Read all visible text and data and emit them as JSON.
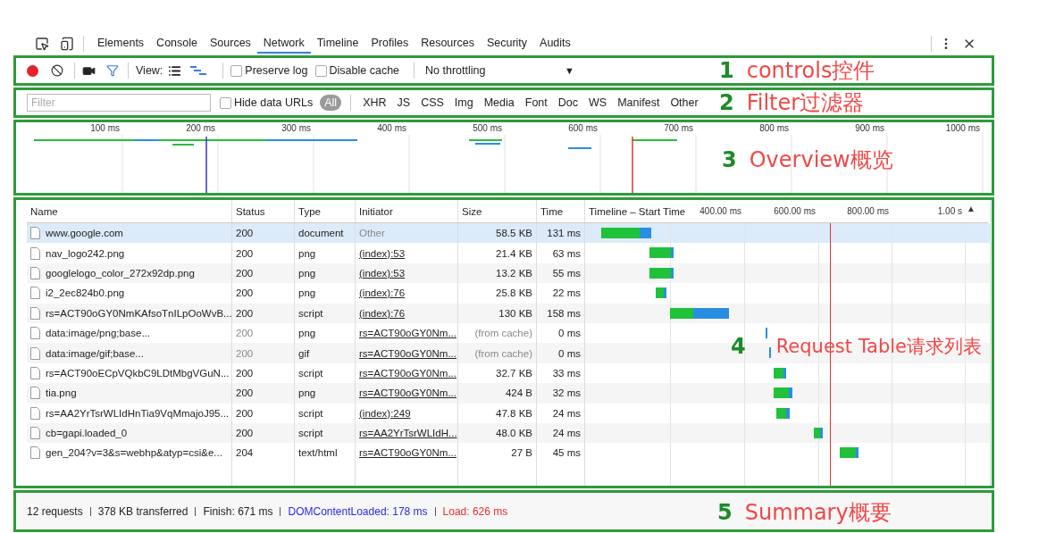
{
  "devtools_tabs": [
    {
      "label": "Elements",
      "selected": false
    },
    {
      "label": "Console",
      "selected": false
    },
    {
      "label": "Sources",
      "selected": false
    },
    {
      "label": "Network",
      "selected": true
    },
    {
      "label": "Timeline",
      "selected": false
    },
    {
      "label": "Profiles",
      "selected": false
    },
    {
      "label": "Resources",
      "selected": false
    },
    {
      "label": "Security",
      "selected": false
    },
    {
      "label": "Audits",
      "selected": false
    }
  ],
  "controls": {
    "record_on": true,
    "filter_on": true,
    "view_label": "View:",
    "view_modes": [
      {
        "kind": "list",
        "selected": false
      },
      {
        "kind": "waterfall",
        "selected": true
      }
    ],
    "preserve_log": {
      "label": "Preserve log",
      "checked": false
    },
    "disable_cache": {
      "label": "Disable cache",
      "checked": false
    },
    "throttling": "No throttling",
    "dropdown_arrow": "▼",
    "annotation": {
      "number": "1",
      "label": "controls控件"
    }
  },
  "filter": {
    "placeholder": "Filter",
    "hide_data_urls": {
      "label": "Hide data URLs",
      "checked": false
    },
    "types": [
      {
        "label": "All",
        "selected": true
      },
      {
        "label": "XHR",
        "selected": false
      },
      {
        "label": "JS",
        "selected": false
      },
      {
        "label": "CSS",
        "selected": false
      },
      {
        "label": "Img",
        "selected": false
      },
      {
        "label": "Media",
        "selected": false
      },
      {
        "label": "Font",
        "selected": false
      },
      {
        "label": "Doc",
        "selected": false
      },
      {
        "label": "WS",
        "selected": false
      },
      {
        "label": "Manifest",
        "selected": false
      },
      {
        "label": "Other",
        "selected": false
      }
    ],
    "annotation": {
      "number": "2",
      "label": "Filter过滤器"
    }
  },
  "overview": {
    "ticks": [
      "100 ms",
      "200 ms",
      "300 ms",
      "400 ms",
      "500 ms",
      "600 ms",
      "700 ms",
      "800 ms",
      "900 ms",
      "1000 ms"
    ],
    "annotation": {
      "number": "3",
      "label": "Overview概览"
    }
  },
  "requests": {
    "columns": [
      "Name",
      "Status",
      "Type",
      "Initiator",
      "Size",
      "Time",
      "Timeline – Start Time"
    ],
    "timeline_ticks": [
      "400.00 ms",
      "600.00 ms",
      "800.00 ms",
      "1.00 s"
    ],
    "sort_indicator": "▲",
    "rows": [
      {
        "name": "www.google.com",
        "status": "200",
        "type": "document",
        "initiator": "Other",
        "initiator_link": false,
        "size": "58.5 KB",
        "time": "131 ms",
        "cached": false,
        "selected": true
      },
      {
        "name": "nav_logo242.png",
        "status": "200",
        "type": "png",
        "initiator": "(index):53",
        "initiator_link": true,
        "size": "21.4 KB",
        "time": "63 ms",
        "cached": false,
        "selected": false
      },
      {
        "name": "googlelogo_color_272x92dp.png",
        "status": "200",
        "type": "png",
        "initiator": "(index):53",
        "initiator_link": true,
        "size": "13.2 KB",
        "time": "55 ms",
        "cached": false,
        "selected": false
      },
      {
        "name": "i2_2ec824b0.png",
        "status": "200",
        "type": "png",
        "initiator": "(index):76",
        "initiator_link": true,
        "size": "25.8 KB",
        "time": "22 ms",
        "cached": false,
        "selected": false
      },
      {
        "name": "rs=ACT90oGY0NmKAfsoTnILpOoWvB...",
        "status": "200",
        "type": "script",
        "initiator": "(index):76",
        "initiator_link": true,
        "size": "130 KB",
        "time": "158 ms",
        "cached": false,
        "selected": false
      },
      {
        "name": "data:image/png;base...",
        "status": "200",
        "type": "png",
        "initiator": "rs=ACT90oGY0Nm...",
        "initiator_link": true,
        "size": "(from cache)",
        "time": "0 ms",
        "cached": true,
        "selected": false
      },
      {
        "name": "data:image/gif;base...",
        "status": "200",
        "type": "gif",
        "initiator": "rs=ACT90oGY0Nm...",
        "initiator_link": true,
        "size": "(from cache)",
        "time": "0 ms",
        "cached": true,
        "selected": false
      },
      {
        "name": "rs=ACT90oECpVQkbC9LDtMbgVGuN...",
        "status": "200",
        "type": "script",
        "initiator": "rs=ACT90oGY0Nm...",
        "initiator_link": true,
        "size": "32.7 KB",
        "time": "33 ms",
        "cached": false,
        "selected": false
      },
      {
        "name": "tia.png",
        "status": "200",
        "type": "png",
        "initiator": "rs=ACT90oGY0Nm...",
        "initiator_link": true,
        "size": "424 B",
        "time": "32 ms",
        "cached": false,
        "selected": false
      },
      {
        "name": "rs=AA2YrTsrWLIdHnTia9VqMmajoJ95...",
        "status": "200",
        "type": "script",
        "initiator": "(index):249",
        "initiator_link": true,
        "size": "47.8 KB",
        "time": "24 ms",
        "cached": false,
        "selected": false
      },
      {
        "name": "cb=gapi.loaded_0",
        "status": "200",
        "type": "script",
        "initiator": "rs=AA2YrTsrWLIdH...",
        "initiator_link": true,
        "size": "48.0 KB",
        "time": "24 ms",
        "cached": false,
        "selected": false
      },
      {
        "name": "gen_204?v=3&s=webhp&atyp=csi&e...",
        "status": "204",
        "type": "text/html",
        "initiator": "rs=ACT90oGY0Nm...",
        "initiator_link": true,
        "size": "27 B",
        "time": "45 ms",
        "cached": false,
        "selected": false
      }
    ],
    "annotation": {
      "number": "4",
      "label": "Request Table请求列表"
    }
  },
  "summary": {
    "items": [
      {
        "text": "12 requests",
        "kind": "plain"
      },
      {
        "text": "378 KB transferred",
        "kind": "plain"
      },
      {
        "text": "Finish: 671 ms",
        "kind": "plain"
      },
      {
        "text": "DOMContentLoaded: 178 ms",
        "kind": "dom"
      },
      {
        "text": "Load: 626 ms",
        "kind": "load"
      }
    ],
    "annotation": {
      "number": "5",
      "label": "Summary概要"
    }
  }
}
